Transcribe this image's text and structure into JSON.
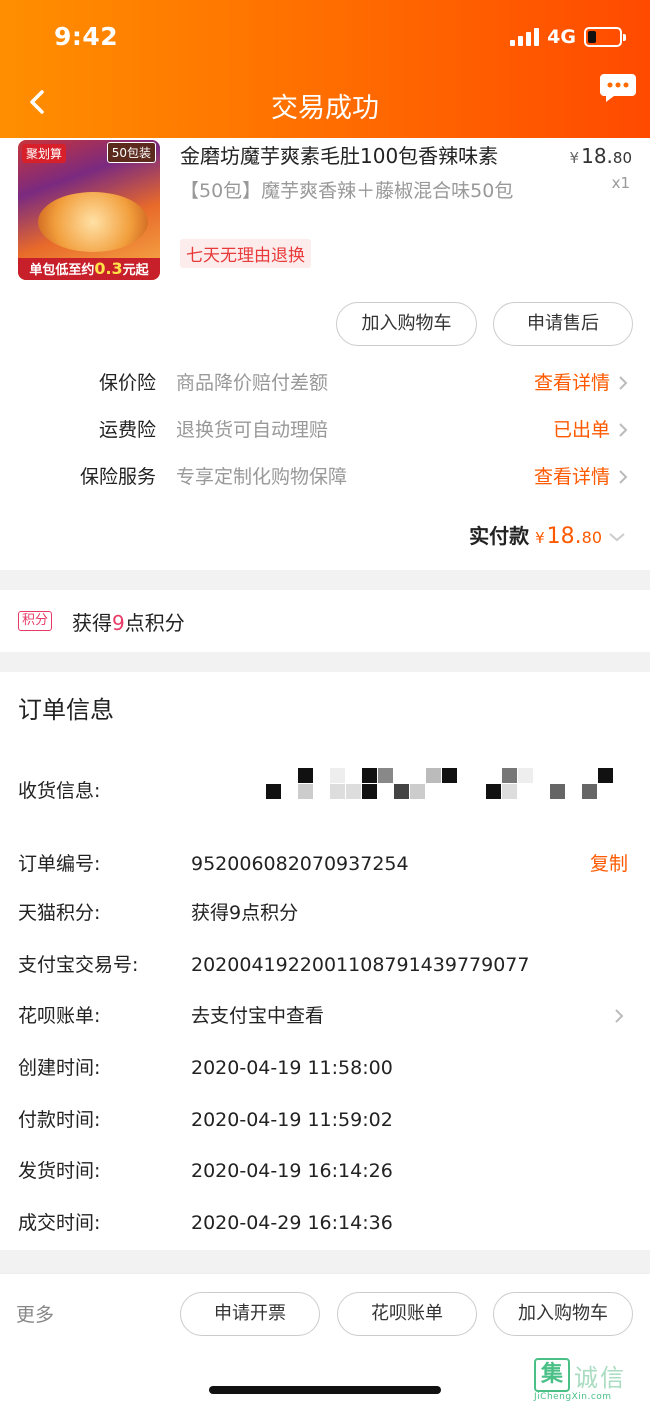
{
  "status_bar": {
    "time": "9:42",
    "network": "4G"
  },
  "header": {
    "title": "交易成功"
  },
  "product": {
    "thumb_tag": "聚划算",
    "thumb_pack": "50包装",
    "thumb_bottom_prefix": "单包低至约",
    "thumb_bottom_price": "0.3",
    "thumb_bottom_suffix": "元起",
    "title": "金磨坊魔芋爽素毛肚100包香辣味素",
    "spec": "【50包】魔芋爽香辣＋藤椒混合味50包",
    "return_tag": "七天无理由退换",
    "price_symbol": "¥",
    "price_int": "18.",
    "price_dec": "80",
    "quantity": "x1",
    "add_cart_label": "加入购物车",
    "after_sale_label": "申请售后"
  },
  "services": [
    {
      "label": "保价险",
      "desc": "商品降价赔付差额",
      "link": "查看详情"
    },
    {
      "label": "运费险",
      "desc": "退换货可自动理赔",
      "link": "已出单"
    },
    {
      "label": "保险服务",
      "desc": "专享定制化购物保障",
      "link": "查看详情"
    }
  ],
  "payment": {
    "label": "实付款",
    "symbol": "¥",
    "int": "18.",
    "dec": "80"
  },
  "points": {
    "badge": "积分",
    "prefix": "获得",
    "num": "9",
    "suffix": "点积分"
  },
  "order_info": {
    "title": "订单信息",
    "address_label": "收货信息:",
    "rows": [
      {
        "label": "订单编号:",
        "value": "952006082070937254",
        "action": "复制"
      },
      {
        "label": "天猫积分:",
        "value": "获得9点积分"
      },
      {
        "label": "支付宝交易号:",
        "value": "2020041922001108791439779077"
      },
      {
        "label": "花呗账单:",
        "value": "去支付宝中查看"
      },
      {
        "label": "创建时间:",
        "value": "2020-04-19 11:58:00"
      },
      {
        "label": "付款时间:",
        "value": "2020-04-19 11:59:02"
      },
      {
        "label": "发货时间:",
        "value": "2020-04-19 16:14:26"
      },
      {
        "label": "成交时间:",
        "value": "2020-04-29 16:14:36"
      }
    ]
  },
  "bottom_bar": {
    "more": "更多",
    "invoice": "申请开票",
    "huabei": "花呗账单",
    "cart": "加入购物车"
  },
  "watermark": {
    "box": "集",
    "text": "诚信",
    "sub": "JiChengXin.com"
  },
  "colors": {
    "accent": "#ff5a00",
    "header_start": "#ff8f00",
    "header_end": "#ff4a00",
    "points": "#e83a66"
  }
}
